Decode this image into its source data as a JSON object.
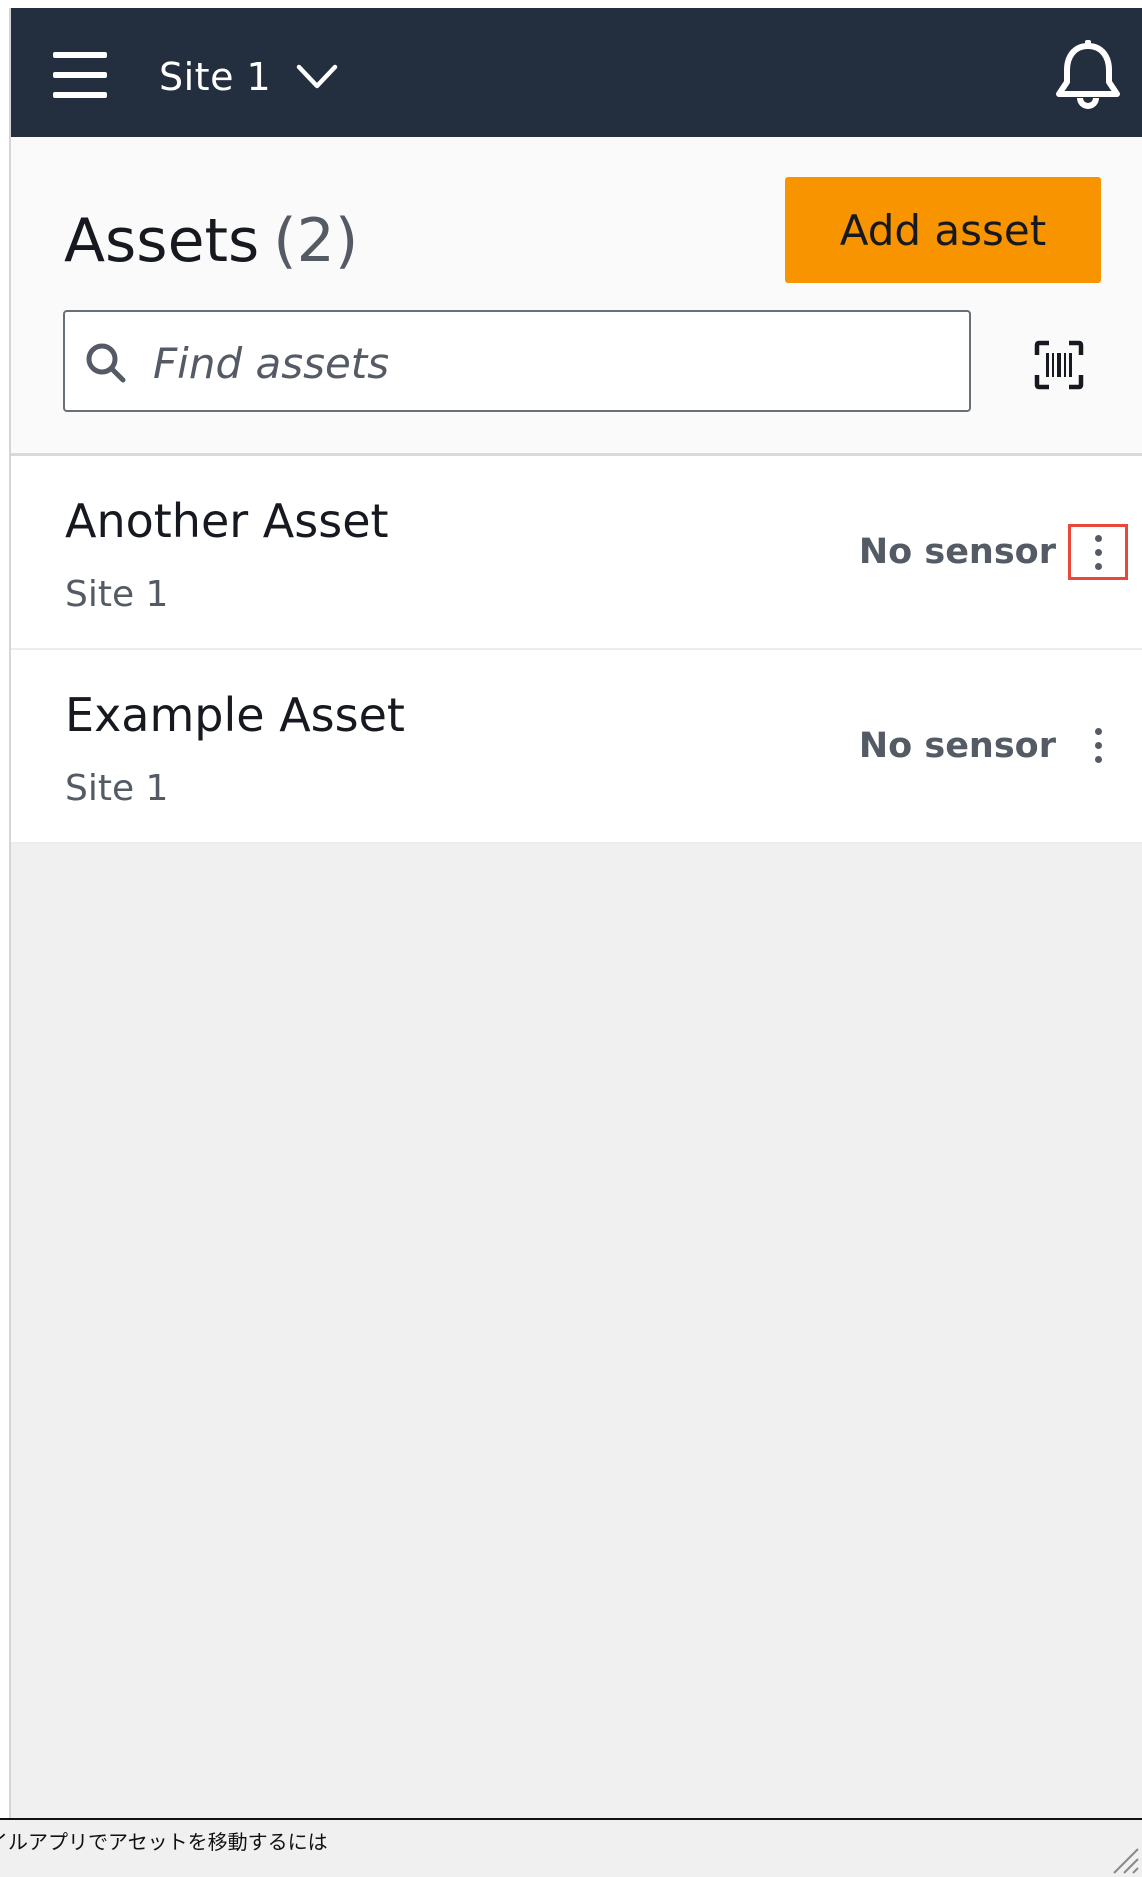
{
  "topbar": {
    "site_selector": "Site 1",
    "icons": [
      "hamburger-menu-icon",
      "chevron-down-icon",
      "bell-icon"
    ],
    "background": "#232f3e"
  },
  "header": {
    "title": "Assets",
    "count": "(2)",
    "add_button_label": "Add asset",
    "accent_color": "#f89400"
  },
  "search": {
    "placeholder": "Find assets",
    "value": "",
    "icons": [
      "search-icon",
      "barcode-scan-icon"
    ]
  },
  "assets": [
    {
      "name": "Another Asset",
      "site": "Site 1",
      "status": "No sensor",
      "menu_highlighted": true
    },
    {
      "name": "Example Asset",
      "site": "Site 1",
      "status": "No sensor",
      "menu_highlighted": false
    }
  ],
  "footer": {
    "caption": "イルアプリでアセットを移動するには"
  }
}
